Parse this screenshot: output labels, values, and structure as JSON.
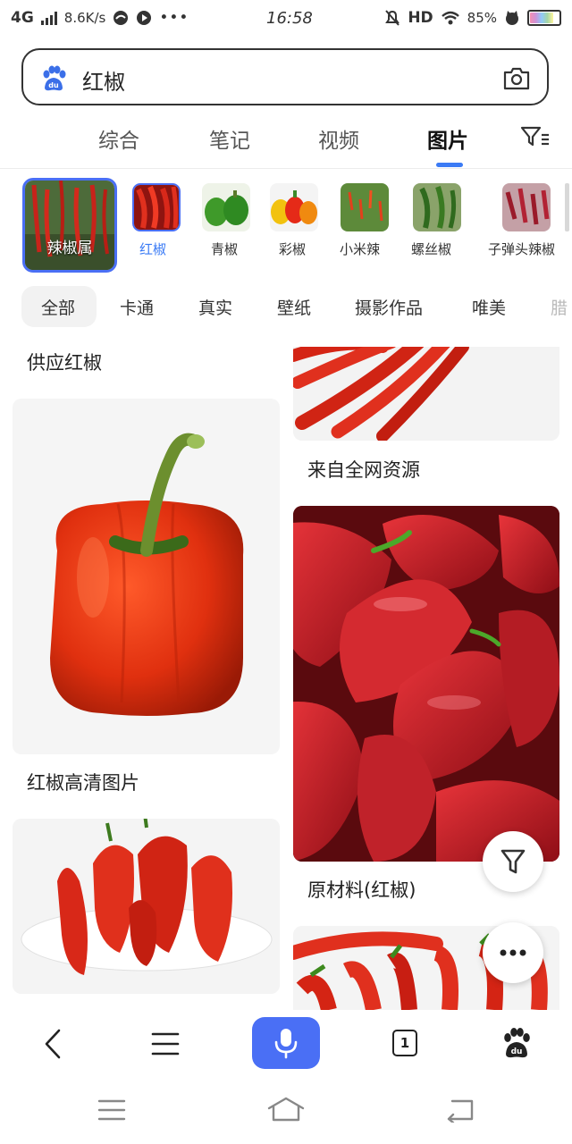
{
  "status_bar": {
    "network": "4G",
    "speed": "8.6K/s",
    "time": "16:58",
    "hd": "HD",
    "battery": "85%"
  },
  "search": {
    "query": "红椒"
  },
  "tabs": [
    {
      "label": "综合"
    },
    {
      "label": "笔记"
    },
    {
      "label": "视频"
    },
    {
      "label": "图片"
    }
  ],
  "related": [
    {
      "label": "辣椒属"
    },
    {
      "label": "红椒"
    },
    {
      "label": "青椒"
    },
    {
      "label": "彩椒"
    },
    {
      "label": "小米辣"
    },
    {
      "label": "螺丝椒"
    },
    {
      "label": "子弹头辣椒"
    }
  ],
  "filters": [
    {
      "label": "全部"
    },
    {
      "label": "卡通"
    },
    {
      "label": "真实"
    },
    {
      "label": "壁纸"
    },
    {
      "label": "摄影作品"
    },
    {
      "label": "唯美"
    },
    {
      "label": "腊"
    }
  ],
  "results": {
    "left_top_caption": "供应红椒",
    "right_top_caption": "来自全网资源",
    "left_mid_caption": "红椒高清图片",
    "right_mid_caption": "原材料(红椒)"
  },
  "bottom_bar": {
    "tab_count": "1"
  },
  "colors": {
    "accent": "#4a6ff5",
    "pepper_red": "#d9291c"
  }
}
